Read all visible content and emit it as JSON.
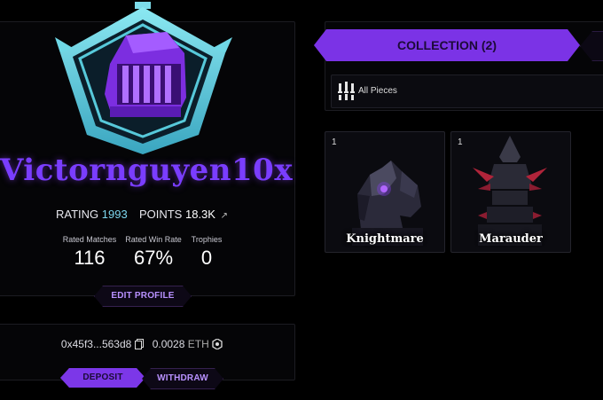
{
  "profile": {
    "username": "Victornguyen10x",
    "rating_label": "RATING",
    "rating_value": "1993",
    "points_label": "POINTS",
    "points_value": "18.3K",
    "points_arrow": "↗",
    "stats": [
      {
        "label": "Rated Matches",
        "value": "116"
      },
      {
        "label": "Rated Win Rate",
        "value": "67%"
      },
      {
        "label": "Trophies",
        "value": "0"
      }
    ],
    "edit_button": "EDIT PROFILE"
  },
  "wallet": {
    "address": "0x45f3...563d8",
    "balance": "0.0028",
    "currency": "ETH",
    "deposit_button": "DEPOSIT",
    "withdraw_button": "WITHDRAW"
  },
  "collection": {
    "tab_label": "COLLECTION (2)",
    "filter_label": "All Pieces",
    "items": [
      {
        "count": "1",
        "name": "Knightmare"
      },
      {
        "count": "1",
        "name": "Marauder"
      }
    ]
  },
  "colors": {
    "accent": "#7b33e6",
    "username": "#7a3dff",
    "rating": "#7dd6ee",
    "emblem_frame": "#4fd0e0"
  },
  "icons": [
    "helmet-emblem",
    "copy-icon",
    "eth-icon",
    "chess-pieces-icon"
  ]
}
